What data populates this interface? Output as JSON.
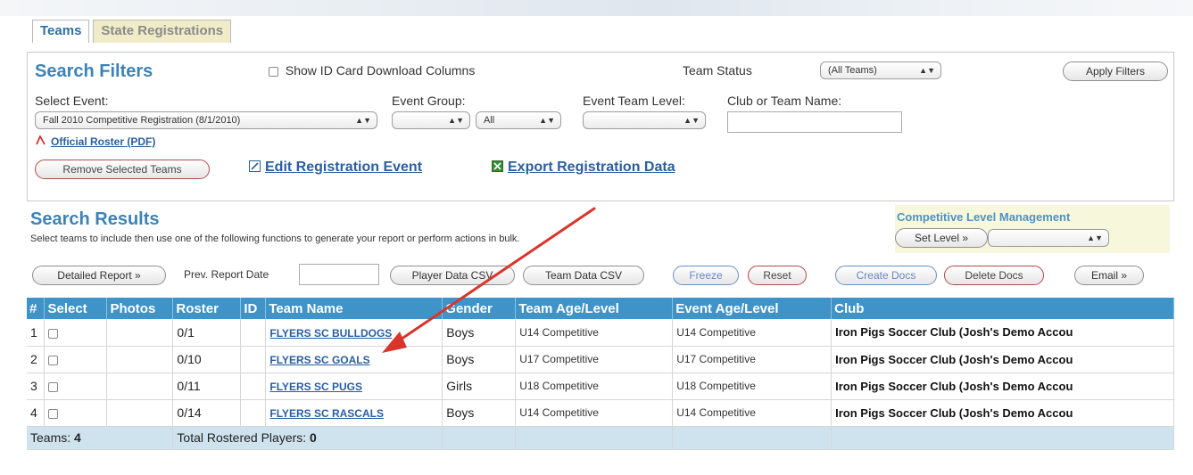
{
  "tabs": [
    {
      "label": "Teams",
      "active": true
    },
    {
      "label": "State Registrations",
      "active": false
    }
  ],
  "filters": {
    "title": "Search Filters",
    "show_id_card_label": "Show ID Card Download Columns",
    "team_status_label": "Team Status",
    "team_status_value": "(All Teams)",
    "apply_label": "Apply Filters",
    "select_event_label": "Select Event:",
    "select_event_value": "Fall 2010 Competitive Registration (8/1/2010)",
    "event_group_label": "Event Group:",
    "event_group_value": "",
    "event_group_all": "All",
    "event_team_level_label": "Event Team Level:",
    "event_team_level_value": "",
    "club_team_label": "Club or Team Name:",
    "club_team_value": "",
    "official_roster_label": "Official Roster (PDF)",
    "remove_selected_label": "Remove Selected Teams",
    "edit_registration_label": "Edit Registration Event",
    "export_registration_label": "Export Registration Data"
  },
  "results": {
    "title": "Search Results",
    "description": "Select teams to include then use one of the following functions to generate your report or perform actions in bulk.",
    "clm_title": "Competitive Level Management",
    "set_level_label": "Set Level »",
    "set_level_select_value": "",
    "buttons": {
      "detailed_report": "Detailed Report »",
      "prev_report_date_label": "Prev. Report Date",
      "prev_report_date_value": "",
      "player_data_csv": "Player Data CSV",
      "team_data_csv": "Team Data CSV",
      "freeze": "Freeze",
      "reset": "Reset",
      "create_docs": "Create Docs",
      "delete_docs": "Delete Docs",
      "email": "Email »"
    }
  },
  "table": {
    "columns": [
      "#",
      "Select",
      "Photos",
      "Roster",
      "ID",
      "Team Name",
      "Gender",
      "Team Age/Level",
      "Event Age/Level",
      "Club"
    ],
    "rows": [
      {
        "num": "1",
        "roster": "0/1",
        "id": "",
        "team": "FLYERS SC BULLDOGS",
        "gender": "Boys",
        "team_age": "U14 Competitive",
        "event_age": "U14 Competitive",
        "club": "Iron Pigs Soccer Club (Josh's Demo Accou"
      },
      {
        "num": "2",
        "roster": "0/10",
        "id": "",
        "team": "FLYERS SC GOALS",
        "gender": "Boys",
        "team_age": "U17 Competitive",
        "event_age": "U17 Competitive",
        "club": "Iron Pigs Soccer Club (Josh's Demo Accou"
      },
      {
        "num": "3",
        "roster": "0/11",
        "id": "",
        "team": "FLYERS SC PUGS",
        "gender": "Girls",
        "team_age": "U18 Competitive",
        "event_age": "U18 Competitive",
        "club": "Iron Pigs Soccer Club (Josh's Demo Accou"
      },
      {
        "num": "4",
        "roster": "0/14",
        "id": "",
        "team": "FLYERS SC RASCALS",
        "gender": "Boys",
        "team_age": "U14 Competitive",
        "event_age": "U14 Competitive",
        "club": "Iron Pigs Soccer Club (Josh's Demo Accou"
      }
    ],
    "footer": {
      "teams_label": "Teams:",
      "teams_count": "4",
      "rostered_label": "Total Rostered Players:",
      "rostered_count": "0"
    }
  },
  "colors": {
    "header_blue": "#3e93c8",
    "title_blue": "#3b83b6",
    "link_blue": "#2a5ea0",
    "annotation_red": "#d9352b"
  }
}
